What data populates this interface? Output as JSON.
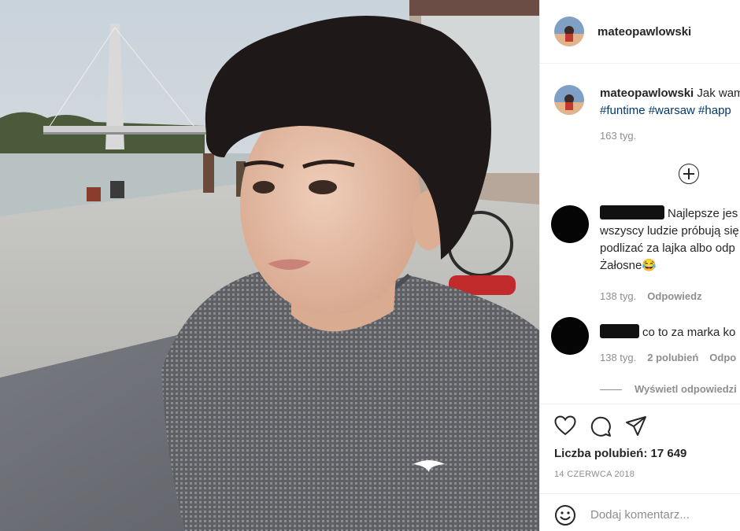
{
  "post": {
    "username": "mateopawlowski",
    "photo_alt": "post-photo"
  },
  "caption": {
    "username": "mateopawlowski",
    "text": "Jak wam",
    "hashtags": "#funtime #warsaw #happ",
    "time": "163 tyg.",
    "load_more_icon": "plus-circle-icon"
  },
  "comments": [
    {
      "line1": "Najlepsze jes",
      "line2": "wszyscy ludzie próbują się",
      "line3": "podlizać za lajka albo odp",
      "line4": "Żałosne😂",
      "time": "138 tyg.",
      "reply": "Odpowiedz"
    },
    {
      "line1": "co to za marka ko",
      "time": "138 tyg.",
      "likes": "2 polubień",
      "reply": "Odpo"
    }
  ],
  "view_replies": "Wyświetl odpowiedzi",
  "actions": {
    "like_icon": "heart-icon",
    "comment_icon": "comment-icon",
    "share_icon": "share-icon"
  },
  "likes_label": "Liczba polubień: 17 649",
  "date": "14 CZERWCA 2018",
  "add_comment": {
    "placeholder": "Dodaj komentarz...",
    "emoji_icon": "emoji-icon"
  }
}
